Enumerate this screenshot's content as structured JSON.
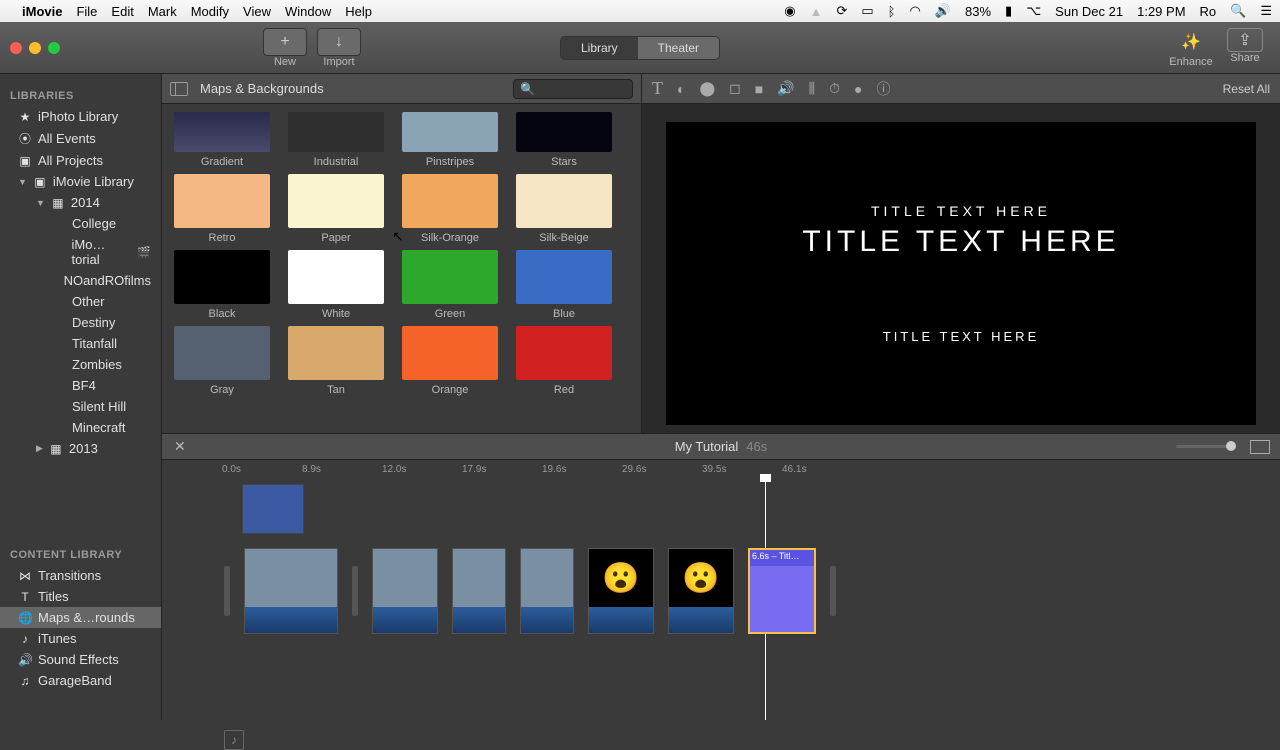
{
  "menubar": {
    "app": "iMovie",
    "items": [
      "File",
      "Edit",
      "Mark",
      "Modify",
      "View",
      "Window",
      "Help"
    ],
    "right": {
      "battery": "83%",
      "date": "Sun Dec 21",
      "time": "1:29 PM",
      "user": "Ro"
    }
  },
  "toolbar": {
    "new": "New",
    "import": "Import",
    "seg": {
      "library": "Library",
      "theater": "Theater"
    },
    "enhance": "Enhance",
    "share": "Share"
  },
  "sidebar": {
    "libraries_header": "LIBRARIES",
    "content_header": "CONTENT LIBRARY",
    "libraries": [
      {
        "label": "iPhoto Library",
        "indent": 0
      },
      {
        "label": "All Events",
        "indent": 0
      },
      {
        "label": "All Projects",
        "indent": 0
      },
      {
        "label": "iMovie Library",
        "indent": 0,
        "disclosure": true
      },
      {
        "label": "2014",
        "indent": 1,
        "disclosure": true
      },
      {
        "label": "College",
        "indent": 2
      },
      {
        "label": "iMo…torial",
        "indent": 2,
        "camera": true
      },
      {
        "label": "NOandROfilms",
        "indent": 2
      },
      {
        "label": "Other",
        "indent": 2
      },
      {
        "label": "Destiny",
        "indent": 2
      },
      {
        "label": "Titanfall",
        "indent": 2
      },
      {
        "label": "Zombies",
        "indent": 2
      },
      {
        "label": "BF4",
        "indent": 2
      },
      {
        "label": "Silent Hill",
        "indent": 2
      },
      {
        "label": "Minecraft",
        "indent": 2
      },
      {
        "label": "2013",
        "indent": 1,
        "disclosure_closed": true
      }
    ],
    "content": [
      {
        "label": "Transitions"
      },
      {
        "label": "Titles"
      },
      {
        "label": "Maps &…rounds",
        "selected": true
      },
      {
        "label": "iTunes"
      },
      {
        "label": "Sound Effects"
      },
      {
        "label": "GarageBand"
      }
    ]
  },
  "browser": {
    "title": "Maps & Backgrounds",
    "backgrounds": [
      [
        {
          "name": "Gradient",
          "color": "linear-gradient(#2a2a4a,#4a4a6a)"
        },
        {
          "name": "Industrial",
          "color": "#2f2f2f"
        },
        {
          "name": "Pinstripes",
          "color": "#8aa3b5"
        },
        {
          "name": "Stars",
          "color": "#050510"
        }
      ],
      [
        {
          "name": "Retro",
          "color": "#f5b783"
        },
        {
          "name": "Paper",
          "color": "#faf5d0"
        },
        {
          "name": "Silk-Orange",
          "color": "#f0a95c"
        },
        {
          "name": "Silk-Beige",
          "color": "#f5e5c5"
        }
      ],
      [
        {
          "name": "Black",
          "color": "#000000"
        },
        {
          "name": "White",
          "color": "#ffffff"
        },
        {
          "name": "Green",
          "color": "#2da82d"
        },
        {
          "name": "Blue",
          "color": "#3a6cc5"
        }
      ],
      [
        {
          "name": "Gray",
          "color": "#556070"
        },
        {
          "name": "Tan",
          "color": "#d8a86a"
        },
        {
          "name": "Orange",
          "color": "#f5622a"
        },
        {
          "name": "Red",
          "color": "#d02020"
        }
      ]
    ]
  },
  "viewer": {
    "reset": "Reset All",
    "title_small": "TITLE TEXT HERE",
    "title_large": "TITLE TEXT HERE",
    "title_bottom": "TITLE TEXT HERE"
  },
  "timeline": {
    "project": "My Tutorial",
    "duration": "46s",
    "ruler": [
      "0.0s",
      "8.9s",
      "12.0s",
      "17.9s",
      "19.6s",
      "29.6s",
      "39.5s",
      "46.1s"
    ],
    "selected_clip": "6.6s – Titl…"
  }
}
